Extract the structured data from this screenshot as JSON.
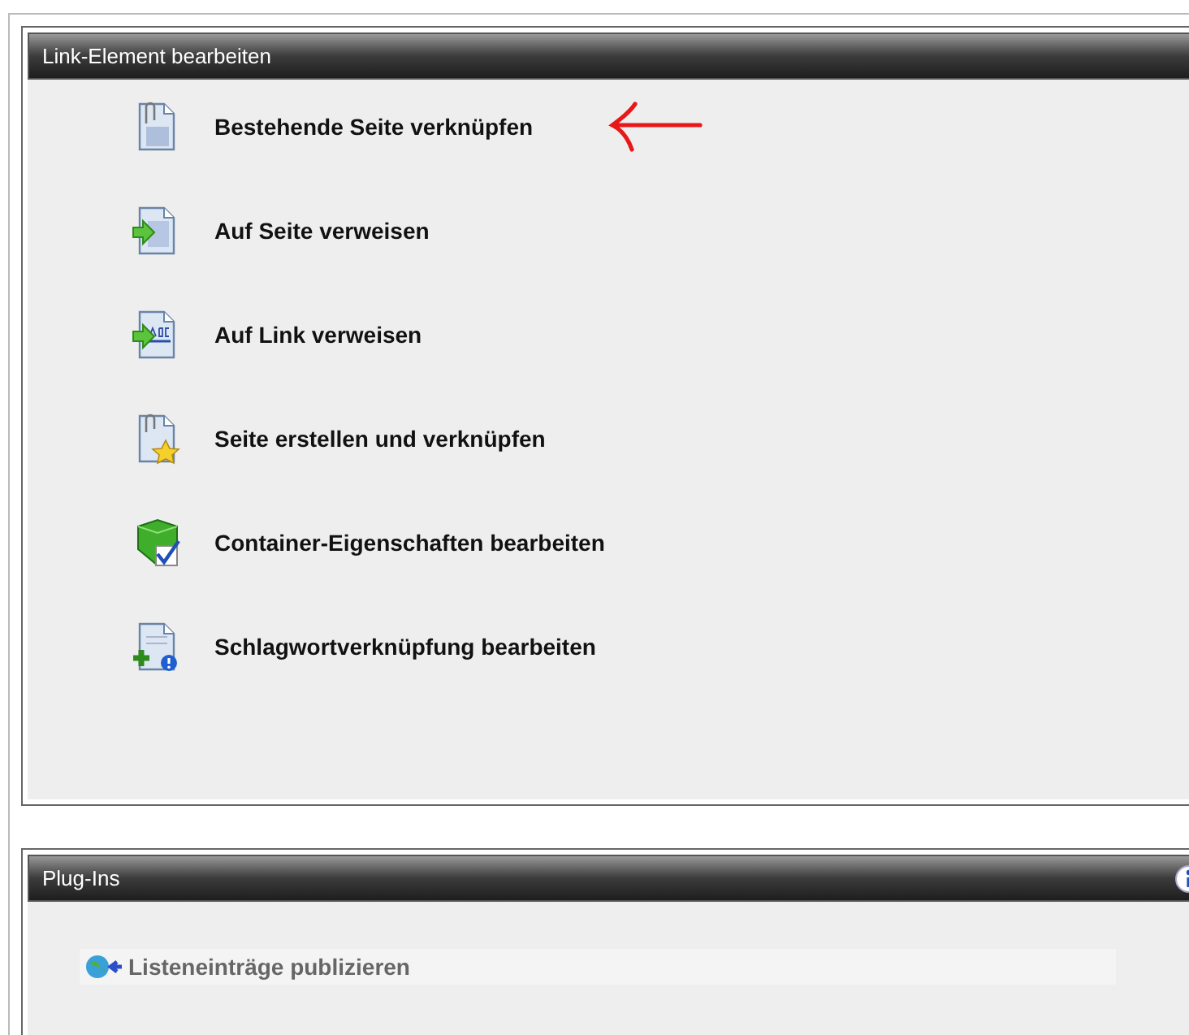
{
  "link_panel": {
    "title": "Link-Element bearbeiten",
    "items": [
      {
        "label": "Bestehende Seite verknüpfen",
        "kind": "page_clip",
        "annotated": true
      },
      {
        "label": "Auf Seite verweisen",
        "kind": "page_arrow",
        "annotated": false
      },
      {
        "label": "Auf Link verweisen",
        "kind": "abc_arrow",
        "annotated": false
      },
      {
        "label": "Seite erstellen und verknüpfen",
        "kind": "page_star",
        "annotated": false
      },
      {
        "label": "Container-Eigenschaften bearbeiten",
        "kind": "cube_check",
        "annotated": false
      },
      {
        "label": "Schlagwortverknüpfung bearbeiten",
        "kind": "page_plus",
        "annotated": false
      }
    ]
  },
  "plugins_panel": {
    "title": "Plug-Ins",
    "items": [
      {
        "label": "Listeneinträge publizieren"
      }
    ]
  }
}
